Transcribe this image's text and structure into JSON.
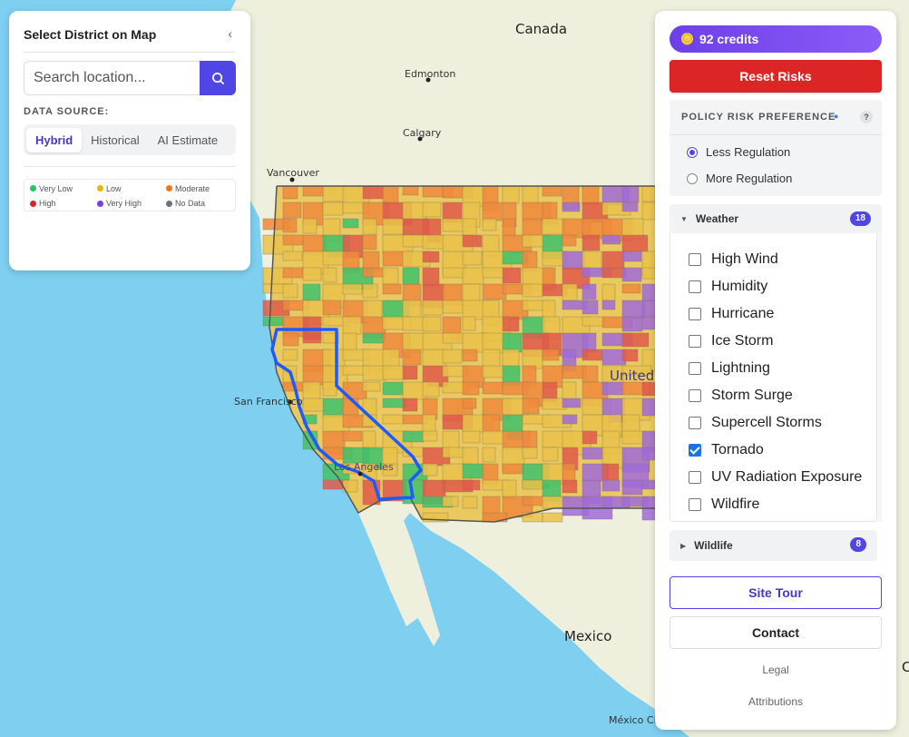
{
  "map": {
    "labels": {
      "canada": "Canada",
      "edmonton": "Edmonton",
      "calgary": "Calgary",
      "vancouver": "Vancouver",
      "san_francisco": "San Francisco",
      "los_angeles": "Los Angeles",
      "united": "United",
      "mexico": "Mexico",
      "mexico_city": "México Ci",
      "edge_c": "C"
    },
    "colors": {
      "ocean": "#7ecff0",
      "land": "#eef0dd",
      "very_low": "#3fc26b",
      "low": "#e9c24a",
      "moderate": "#ef8a3c",
      "high": "#e05a4a",
      "very_high": "#a06bd8",
      "selection": "#1a5cff"
    }
  },
  "left_panel": {
    "title": "Select District on Map",
    "search_placeholder": "Search location...",
    "data_source_label": "DATA SOURCE:",
    "tabs": [
      "Hybrid",
      "Historical",
      "AI Estimate"
    ],
    "active_tab": "Hybrid",
    "legend": [
      {
        "label": "Very Low",
        "color": "#22c55e"
      },
      {
        "label": "Low",
        "color": "#eab308"
      },
      {
        "label": "Moderate",
        "color": "#f97316"
      },
      {
        "label": "High",
        "color": "#dc2626"
      },
      {
        "label": "Very High",
        "color": "#7c3aed"
      },
      {
        "label": "No Data",
        "color": "#6b7280"
      }
    ]
  },
  "right_panel": {
    "credits": "92 credits",
    "reset_label": "Reset Risks",
    "policy": {
      "title": "POLICY RISK PREFERENCE",
      "help": "?",
      "options": [
        "Less Regulation",
        "More Regulation"
      ],
      "selected": "Less Regulation"
    },
    "weather": {
      "title": "Weather",
      "count": "18",
      "items": [
        {
          "label": "High Wind",
          "checked": false
        },
        {
          "label": "Humidity",
          "checked": false
        },
        {
          "label": "Hurricane",
          "checked": false
        },
        {
          "label": "Ice Storm",
          "checked": false
        },
        {
          "label": "Lightning",
          "checked": false
        },
        {
          "label": "Storm Surge",
          "checked": false
        },
        {
          "label": "Supercell Storms",
          "checked": false
        },
        {
          "label": "Tornado",
          "checked": true
        },
        {
          "label": "UV Radiation Exposure",
          "checked": false
        },
        {
          "label": "Wildfire",
          "checked": false
        }
      ]
    },
    "wildlife": {
      "title": "Wildlife",
      "count": "8"
    },
    "site_tour_label": "Site Tour",
    "contact_label": "Contact",
    "legal_label": "Legal",
    "attributions_label": "Attributions"
  }
}
